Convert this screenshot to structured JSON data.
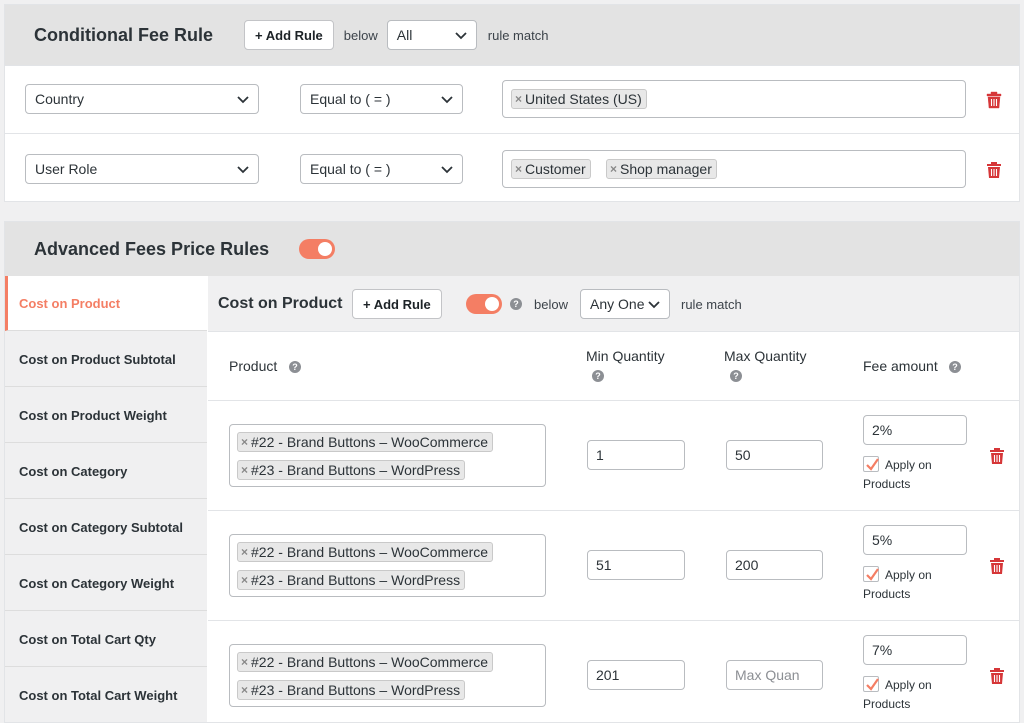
{
  "conditional": {
    "title": "Conditional Fee Rule",
    "add_rule": "+ Add Rule",
    "below": "below",
    "match_value": "All",
    "rule_match": "rule match",
    "rows": [
      {
        "field": "Country",
        "operator": "Equal to ( = )",
        "tags": [
          "United States (US)"
        ]
      },
      {
        "field": "User Role",
        "operator": "Equal to ( = )",
        "tags": [
          "Customer",
          "Shop manager"
        ]
      }
    ]
  },
  "advanced": {
    "title": "Advanced Fees Price Rules",
    "enabled": true,
    "sidebar": [
      "Cost on Product",
      "Cost on Product Subtotal",
      "Cost on Product Weight",
      "Cost on Category",
      "Cost on Category Subtotal",
      "Cost on Category Weight",
      "Cost on Total Cart Qty",
      "Cost on Total Cart Weight"
    ],
    "active_index": 0,
    "section": {
      "title": "Cost on Product",
      "add_rule": "+ Add Rule",
      "below": "below",
      "match_value": "Any One",
      "rule_match": "rule match",
      "headers": {
        "product": "Product",
        "min": "Min Quantity",
        "max": "Max Quantity",
        "fee": "Fee amount"
      },
      "rows": [
        {
          "products": [
            "#22 - Brand Buttons – WooCommerce",
            "#23 - Brand Buttons – WordPress"
          ],
          "min": "1",
          "max": "50",
          "fee": "2%",
          "apply_line1": "Apply on",
          "apply_line2": "Products"
        },
        {
          "products": [
            "#22 - Brand Buttons – WooCommerce",
            "#23 - Brand Buttons – WordPress"
          ],
          "min": "51",
          "max": "200",
          "fee": "5%",
          "apply_line1": "Apply on",
          "apply_line2": "Products"
        },
        {
          "products": [
            "#22 - Brand Buttons – WooCommerce",
            "#23 - Brand Buttons – WordPress"
          ],
          "min": "201",
          "max_placeholder": "Max Quan",
          "fee": "7%",
          "apply_line1": "Apply on",
          "apply_line2": "Products"
        }
      ]
    }
  },
  "colors": {
    "accent": "#f47e64",
    "delete": "#d63638",
    "header_bg": "#e3e3e3"
  }
}
